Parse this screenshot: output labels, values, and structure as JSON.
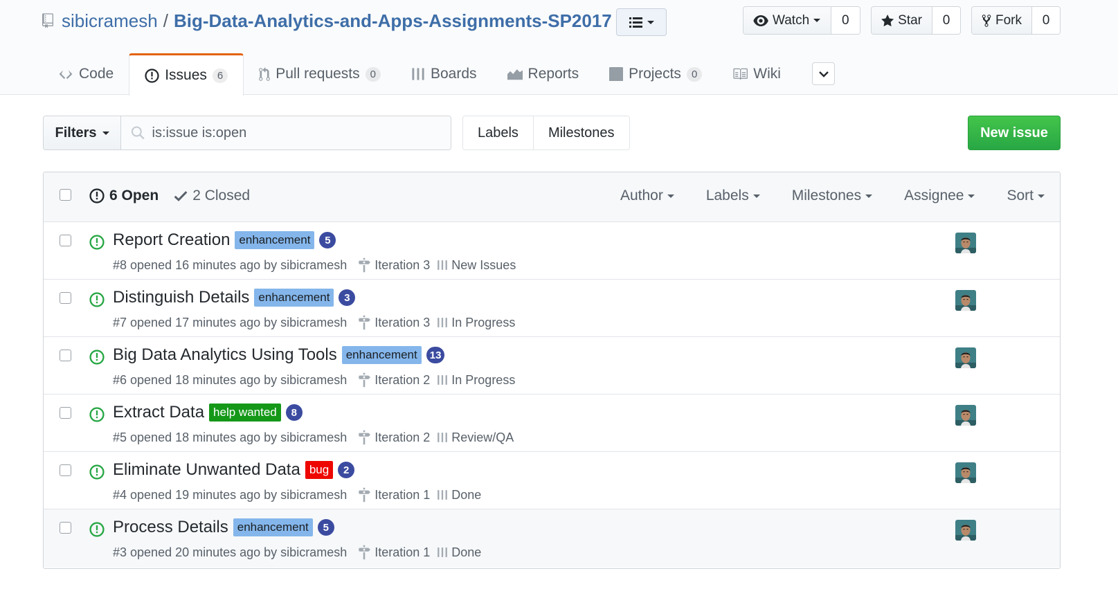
{
  "repo": {
    "owner": "sibicramesh",
    "separator": "/",
    "name": "Big-Data-Analytics-and-Apps-Assignments-SP2017"
  },
  "actions": {
    "watch": {
      "label": "Watch",
      "count": "0"
    },
    "star": {
      "label": "Star",
      "count": "0"
    },
    "fork": {
      "label": "Fork",
      "count": "0"
    }
  },
  "tabs": [
    {
      "label": "Code",
      "icon": "code-icon"
    },
    {
      "label": "Issues",
      "icon": "issue-opened-icon",
      "count": "6",
      "selected": true
    },
    {
      "label": "Pull requests",
      "icon": "git-pull-request-icon",
      "count": "0"
    },
    {
      "label": "Boards",
      "icon": "boards-icon"
    },
    {
      "label": "Reports",
      "icon": "graph-icon"
    },
    {
      "label": "Projects",
      "icon": "project-icon",
      "count": "0"
    },
    {
      "label": "Wiki",
      "icon": "book-icon"
    }
  ],
  "subnav": {
    "filters_label": "Filters",
    "search_value": "is:issue is:open",
    "labels_label": "Labels",
    "milestones_label": "Milestones",
    "new_issue_label": "New issue"
  },
  "issues_header": {
    "open_label": "6 Open",
    "closed_label": "2 Closed",
    "menus": [
      "Author",
      "Labels",
      "Milestones",
      "Assignee",
      "Sort"
    ]
  },
  "colors": {
    "enhancement": "#84b6eb",
    "help_wanted": "#159818",
    "bug": "#ee0701",
    "open_icon": "#28a745",
    "estimate_badge": "#3b4ba0"
  },
  "issues": [
    {
      "title": "Report Creation",
      "label": "enhancement",
      "label_color": "#84b6eb",
      "label_text_color": "#1b1f23",
      "estimate": "5",
      "meta": "#8 opened 16 minutes ago by sibicramesh",
      "milestone": "Iteration 3",
      "pipeline": "New Issues"
    },
    {
      "title": "Distinguish Details",
      "label": "enhancement",
      "label_color": "#84b6eb",
      "label_text_color": "#1b1f23",
      "estimate": "3",
      "meta": "#7 opened 17 minutes ago by sibicramesh",
      "milestone": "Iteration 3",
      "pipeline": "In Progress"
    },
    {
      "title": "Big Data Analytics Using Tools",
      "label": "enhancement",
      "label_color": "#84b6eb",
      "label_text_color": "#1b1f23",
      "estimate": "13",
      "meta": "#6 opened 18 minutes ago by sibicramesh",
      "milestone": "Iteration 2",
      "pipeline": "In Progress"
    },
    {
      "title": "Extract Data",
      "label": "help wanted",
      "label_color": "#159818",
      "label_text_color": "#ffffff",
      "estimate": "8",
      "meta": "#5 opened 18 minutes ago by sibicramesh",
      "milestone": "Iteration 2",
      "pipeline": "Review/QA"
    },
    {
      "title": "Eliminate Unwanted Data",
      "label": "bug",
      "label_color": "#ee0701",
      "label_text_color": "#ffffff",
      "estimate": "2",
      "meta": "#4 opened 19 minutes ago by sibicramesh",
      "milestone": "Iteration 1",
      "pipeline": "Done"
    },
    {
      "title": "Process Details",
      "label": "enhancement",
      "label_color": "#84b6eb",
      "label_text_color": "#1b1f23",
      "estimate": "5",
      "meta": "#3 opened 20 minutes ago by sibicramesh",
      "milestone": "Iteration 1",
      "pipeline": "Done"
    }
  ]
}
